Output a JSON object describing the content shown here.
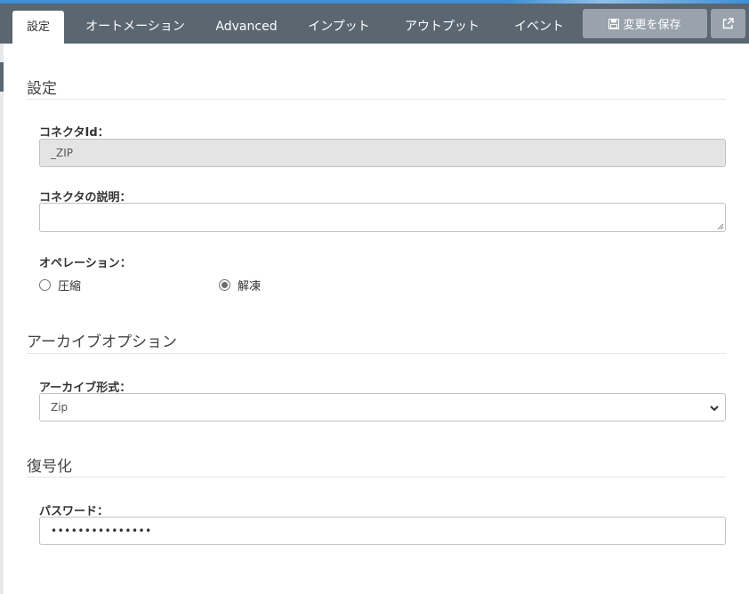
{
  "tabs": [
    {
      "label": "設定",
      "active": true
    },
    {
      "label": "オートメーション",
      "active": false
    },
    {
      "label": "Advanced",
      "active": false
    },
    {
      "label": "インプット",
      "active": false
    },
    {
      "label": "アウトプット",
      "active": false
    },
    {
      "label": "イベント",
      "active": false
    }
  ],
  "toolbar": {
    "save_label": "変更を保存",
    "save_icon": "floppy-disk-icon",
    "open_icon": "external-link-icon"
  },
  "settings_section": {
    "title": "設定",
    "connector_id_label": "コネクタId：",
    "connector_id_value": "_ZIP",
    "description_label": "コネクタの説明：",
    "description_value": "",
    "operation_label": "オペレーション：",
    "operation_options": [
      {
        "label": "圧縮",
        "checked": false
      },
      {
        "label": "解凍",
        "checked": true
      }
    ]
  },
  "archive_section": {
    "title": "アーカイブオプション",
    "format_label": "アーカイブ形式：",
    "format_value": "Zip"
  },
  "decrypt_section": {
    "title": "復号化",
    "password_label": "パスワード：",
    "password_value": "•••••••••••••••"
  },
  "colors": {
    "tabbar": "#5a6670",
    "button": "#9aa3ab",
    "accent_strip": "#3d8fd6"
  }
}
